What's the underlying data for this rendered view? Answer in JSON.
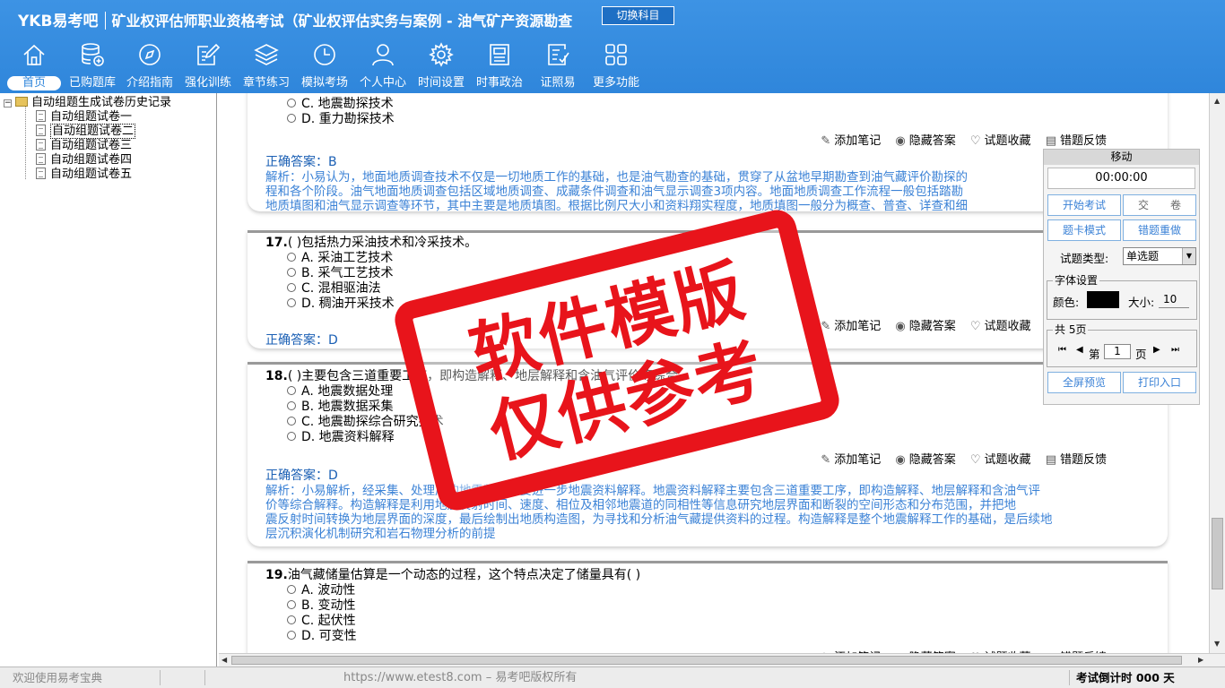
{
  "header": {
    "logo": "YKB易考吧",
    "exam_title": "矿业权评估师职业资格考试（矿业权评估实务与案例 - 油气矿产资源勘查",
    "switch_label": "切换科目"
  },
  "nav": [
    {
      "label": "首页",
      "icon": "home-icon"
    },
    {
      "label": "已购题库",
      "icon": "database-icon"
    },
    {
      "label": "介绍指南",
      "icon": "compass-icon"
    },
    {
      "label": "强化训练",
      "icon": "edit-icon"
    },
    {
      "label": "章节练习",
      "icon": "layers-icon"
    },
    {
      "label": "模拟考场",
      "icon": "clock-icon"
    },
    {
      "label": "个人中心",
      "icon": "user-icon"
    },
    {
      "label": "时间设置",
      "icon": "gear-icon"
    },
    {
      "label": "时事政治",
      "icon": "news-icon"
    },
    {
      "label": "证照易",
      "icon": "checklist-icon"
    },
    {
      "label": "更多功能",
      "icon": "grid-icon"
    }
  ],
  "tree": {
    "root": "自动组题生成试卷历史记录",
    "items": [
      "自动组题试卷一",
      "自动组题试卷二",
      "自动组题试卷三",
      "自动组题试卷四",
      "自动组题试卷五"
    ],
    "selected_index": 1
  },
  "actions": {
    "add_note": "添加笔记",
    "hide_answer": "隐藏答案",
    "favorite": "试题收藏",
    "report_error": "错题反馈"
  },
  "q16": {
    "opt_c": "C. 地震勘探技术",
    "opt_d": "D. 重力勘探技术",
    "answer": "正确答案：B",
    "analysis_1": "解析：小易认为，地面地质调查技术不仅是一切地质工作的基础，也是油气勘查的基础，贯穿了从盆地早期勘查到油气藏评价勘探的",
    "analysis_2": "程和各个阶段。油气地面地质调查包括区域地质调查、成藏条件调查和油气显示调查3项内容。地面地质调查工作流程一般包括踏勘",
    "analysis_3": "地质填图和油气显示调查等环节，其中主要是地质填图。根据比例尺大小和资料翔实程度，地质填图一般分为概查、普查、详查和细"
  },
  "q17": {
    "number": "17.",
    "stem": "( )包括热力采油技术和冷采技术。",
    "opts": [
      "A. 采油工艺技术",
      "B. 采气工艺技术",
      "C. 混相驱油法",
      "D. 稠油开采技术"
    ],
    "answer": "正确答案：D"
  },
  "q18": {
    "number": "18.",
    "stem": "( )主要包含三道重要工序，即构造解释、地层解释和含油气评价等综合",
    "opts": [
      "A. 地震数据处理",
      "B. 地震数据采集",
      "C. 地震勘探综合研究技术",
      "D. 地震资料解释"
    ],
    "answer": "正确答案：D",
    "analysis_1": "解析：小易解析，经采集、处理后的地震数据需要进一步地震资料解释。地震资料解释主要包含三道重要工序，即构造解释、地层解释和含油气评",
    "analysis_2": "价等综合解释。构造解释是利用地震反射时间、速度、相位及相邻地震道的同相性等信息研究地层界面和断裂的空间形态和分布范围，并把地",
    "analysis_3": "震反射时间转换为地层界面的深度，最后绘制出地质构造图，为寻找和分析油气藏提供资料的过程。构造解释是整个地震解释工作的基础，是后续地",
    "analysis_4": "层沉积演化机制研究和岩石物理分析的前提"
  },
  "q19": {
    "number": "19.",
    "stem": "油气藏储量估算是一个动态的过程，这个特点决定了储量具有( )",
    "opts": [
      "A. 波动性",
      "B. 变动性",
      "C. 起伏性",
      "D. 可变性"
    ]
  },
  "panel": {
    "title": "移动",
    "timer": "00:00:00",
    "start_exam": "开始考试",
    "submit": "交　　卷",
    "card_mode": "题卡模式",
    "redo_wrong": "错题重做",
    "type_label": "试题类型:",
    "type_value": "单选题",
    "font_group": "字体设置",
    "color_label": "颜色:",
    "size_label": "大小:",
    "size_value": "10",
    "color_value": "#000000",
    "pages_group": "共 5页",
    "page_prefix": "第",
    "page_value": "1",
    "page_suffix": "页",
    "fullscreen": "全屏预览",
    "print": "打印入口"
  },
  "watermark": {
    "line1": "软件模版",
    "line2": "仅供参考"
  },
  "status": {
    "welcome": "欢迎使用易考宝典",
    "url": "https://www.etest8.com – 易考吧版权所有",
    "countdown": "考试倒计时 000 天"
  },
  "colors": {
    "header_bg": "#2f86db",
    "answer_text": "#1a5fb4",
    "analysis_text": "#3b82d6",
    "stamp_red": "#e8141b"
  }
}
